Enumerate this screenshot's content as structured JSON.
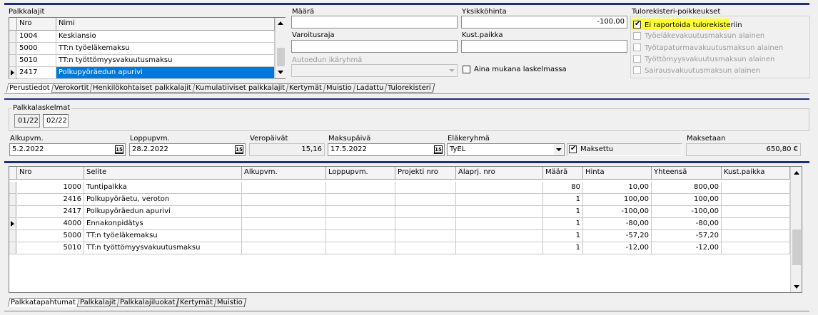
{
  "palkkalajit": {
    "title": "Palkkalajit",
    "col_nro": "Nro",
    "col_nimi": "Nimi",
    "rows": [
      {
        "nro": "1004",
        "nimi": "Keskiansio"
      },
      {
        "nro": "5000",
        "nimi": "TT:n työeläkemaksu"
      },
      {
        "nro": "5010",
        "nimi": "TT:n työttömyysvakuutusmaksu"
      },
      {
        "nro": "2417",
        "nimi": "Polkupyöräedun apurivi"
      }
    ]
  },
  "fields": {
    "maara_label": "Määrä",
    "maara_value": "",
    "yksikkohinta_label": "Yksikköhinta",
    "yksikkohinta_value": "-100,00",
    "varoitusraja_label": "Varoitusraja",
    "varoitusraja_value": "",
    "kustpaikka_label": "Kust.paikka",
    "kustpaikka_value": "",
    "autoedun_label": "Autoedun ikäryhmä",
    "autoedun_value": "",
    "aina_mukana_label": "Aina mukana laskelmassa"
  },
  "tulorekisteri": {
    "title": "Tulorekisteri-poikkeukset",
    "items": [
      {
        "label": "Ei raportoida tulorekisteriin",
        "checked": true
      },
      {
        "label": "Työeläkevakuutusmaksun alainen",
        "checked": false
      },
      {
        "label": "Työtapaturmavakuutusmaksun alainen",
        "checked": false
      },
      {
        "label": "Työttömyysvakuutusmaksun alainen",
        "checked": false
      },
      {
        "label": "Sairausvakuutusmaksun alainen",
        "checked": false
      }
    ]
  },
  "top_tabs": [
    "Perustiedot",
    "Verokortit",
    "Henkilökohtaiset palkkalajit",
    "Kumulatiiviset palkkalajit",
    "Kertymät",
    "Muistio",
    "Ladattu",
    "Tulorekisteri"
  ],
  "palkkalaskelmat": {
    "title": "Palkkalaskelmat",
    "buttons": [
      "01/22",
      "02/22"
    ]
  },
  "details": {
    "alkupvm_label": "Alkupvm.",
    "alkupvm_value": "5.2.2022",
    "loppupvm_label": "Loppupvm.",
    "loppupvm_value": "28.2.2022",
    "veropaivat_label": "Veropäivät",
    "veropaivat_value": "15,16",
    "maksupaiva_label": "Maksupäivä",
    "maksupaiva_value": "17.5.2022",
    "elakeryhma_label": "Eläkeryhmä",
    "elakeryhma_value": "TyEL",
    "maksettu_label": "Maksettu",
    "maksetaan_label": "Maksetaan",
    "maksetaan_value": "650,80 €",
    "cal_icon": "15"
  },
  "tapahtumat": {
    "headers": [
      "Nro",
      "Selite",
      "Alkupvm.",
      "Loppupvm.",
      "Projekti nro",
      "Alaprj. nro",
      "Määrä",
      "Hinta",
      "Yhteensä",
      "Kust.paikka"
    ],
    "rows": [
      {
        "nro": "1000",
        "selite": "Tuntipalkka",
        "maara": "80",
        "hinta": "10,00",
        "yhteensa": "800,00"
      },
      {
        "nro": "2416",
        "selite": "Polkupyöräetu, veroton",
        "maara": "1",
        "hinta": "100,00",
        "yhteensa": "100,00"
      },
      {
        "nro": "2417",
        "selite": "Polkupyöräedun apurivi",
        "maara": "1",
        "hinta": "-100,00",
        "yhteensa": "-100,00"
      },
      {
        "nro": "4000",
        "selite": "Ennakonpidätys",
        "maara": "1",
        "hinta": "-80,00",
        "yhteensa": "-80,00"
      },
      {
        "nro": "5000",
        "selite": "TT:n työeläkemaksu",
        "maara": "1",
        "hinta": "-57,20",
        "yhteensa": "-57,20"
      },
      {
        "nro": "5010",
        "selite": "TT:n työttömyysvakuutusmaksu",
        "maara": "1",
        "hinta": "-12,00",
        "yhteensa": "-12,00"
      }
    ]
  },
  "bottom_tabs": [
    "Palkkatapahtumat",
    "Palkkalajit",
    "Palkkalajiluokat",
    "Kertymät",
    "Muistio"
  ],
  "colors": {
    "navy": "#1c2f7a",
    "selection": "#0078d7",
    "highlight": "#ffff33"
  }
}
